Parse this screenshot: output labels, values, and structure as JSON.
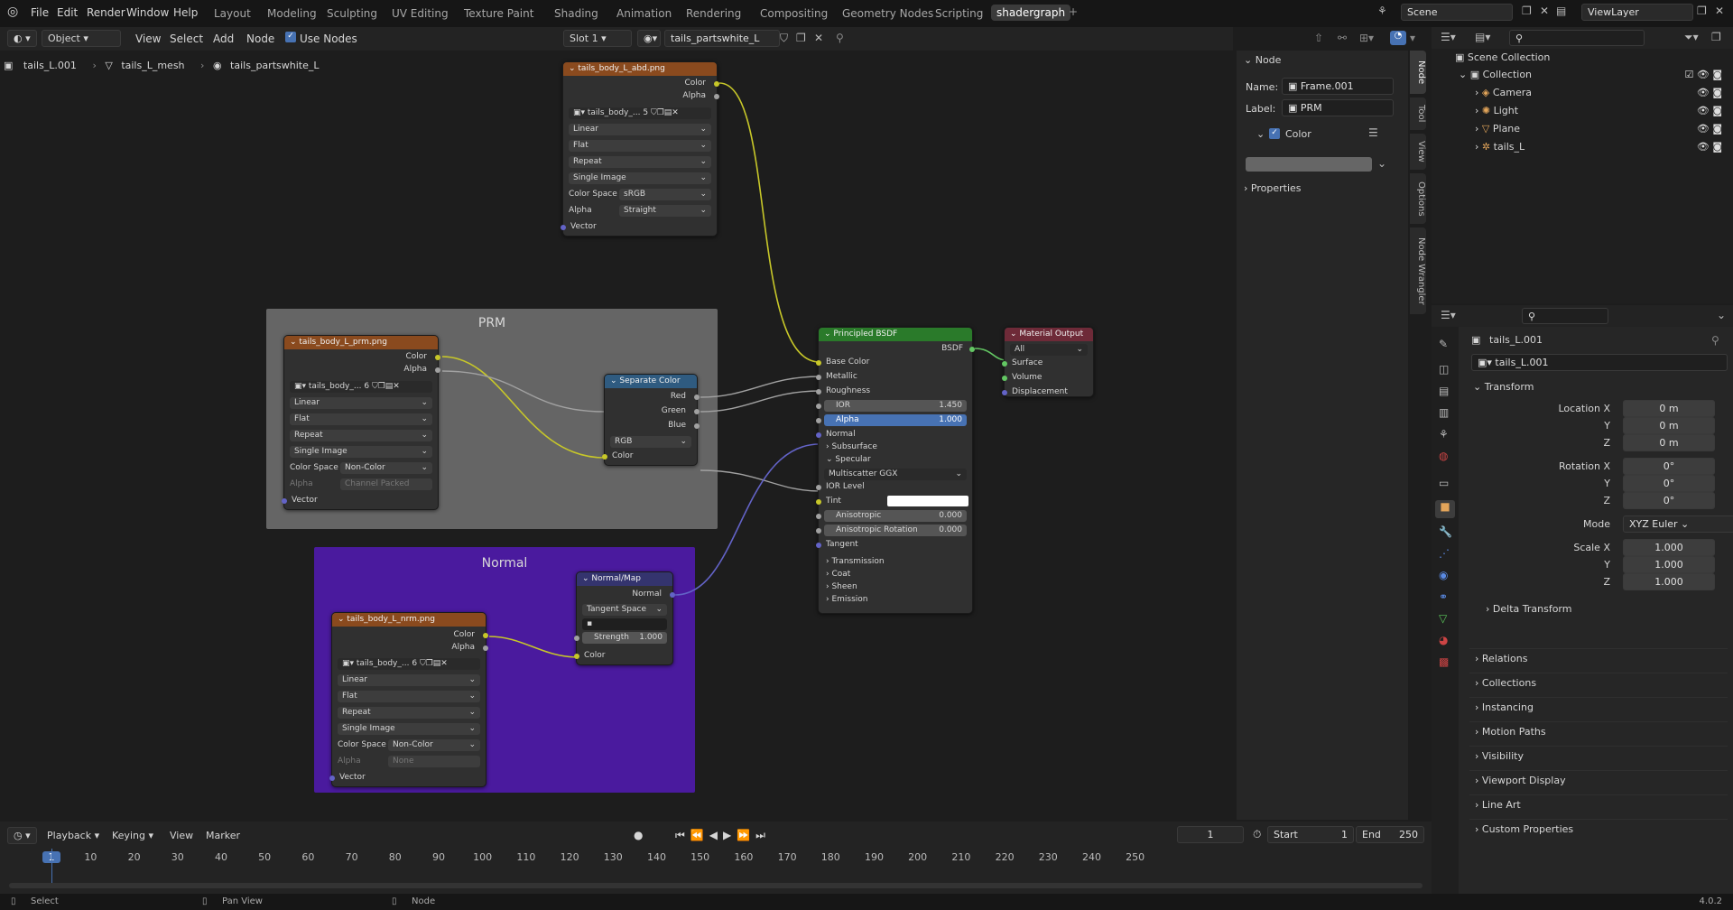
{
  "topbar": {
    "menus": [
      "File",
      "Edit",
      "Render",
      "Window",
      "Help"
    ],
    "workspaces": [
      "Layout",
      "Modeling",
      "Sculpting",
      "UV Editing",
      "Texture Paint",
      "Shading",
      "Animation",
      "Rendering",
      "Compositing",
      "Geometry Nodes",
      "Scripting",
      "shadergraph"
    ],
    "scene": "Scene",
    "viewlayer": "ViewLayer"
  },
  "header": {
    "mode": "Object",
    "menus": [
      "View",
      "Select",
      "Add",
      "Node"
    ],
    "use_nodes": "Use Nodes",
    "slot": "Slot 1",
    "material": "tails_partswhite_L"
  },
  "breadcrumb": [
    "tails_L.001",
    "tails_L_mesh",
    "tails_partswhite_L"
  ],
  "frames": {
    "prm": "PRM",
    "normal": "Normal"
  },
  "nodes": {
    "abd": {
      "title": "tails_body_L_abd.png",
      "out": [
        "Color",
        "Alpha"
      ],
      "img": "tails_body_...",
      "users": "5",
      "rows": [
        "Linear",
        "Flat",
        "Repeat",
        "Single Image"
      ],
      "cs_label": "Color Space",
      "cs": "sRGB",
      "alpha_label": "Alpha",
      "alpha": "Straight",
      "vector": "Vector"
    },
    "prm": {
      "title": "tails_body_L_prm.png",
      "out": [
        "Color",
        "Alpha"
      ],
      "img": "tails_body_...",
      "users": "6",
      "rows": [
        "Linear",
        "Flat",
        "Repeat",
        "Single Image"
      ],
      "cs_label": "Color Space",
      "cs": "Non-Color",
      "alpha_label": "Alpha",
      "alpha": "Channel Packed",
      "vector": "Vector"
    },
    "sep": {
      "title": "Separate Color",
      "out": [
        "Red",
        "Green",
        "Blue"
      ],
      "mode": "RGB",
      "in": "Color"
    },
    "nrm": {
      "title": "tails_body_L_nrm.png",
      "out": [
        "Color",
        "Alpha"
      ],
      "img": "tails_body_...",
      "users": "6",
      "rows": [
        "Linear",
        "Flat",
        "Repeat",
        "Single Image"
      ],
      "cs_label": "Color Space",
      "cs": "Non-Color",
      "alpha_label": "Alpha",
      "alpha": "None",
      "vector": "Vector"
    },
    "nmap": {
      "title": "Normal/Map",
      "out": "Normal",
      "space": "Tangent Space",
      "strength_label": "Strength",
      "strength": "1.000",
      "in": "Color"
    },
    "bsdf": {
      "title": "Principled BSDF",
      "out": "BSDF",
      "inputs": [
        "Base Color",
        "Metallic",
        "Roughness"
      ],
      "ior_label": "IOR",
      "ior": "1.450",
      "alpha_label": "Alpha",
      "alpha": "1.000",
      "normal": "Normal",
      "subsurface": "Subsurface",
      "specular": "Specular",
      "dist": "Multiscatter GGX",
      "ior_level": "IOR Level",
      "tint": "Tint",
      "aniso_label": "Anisotropic",
      "aniso": "0.000",
      "aniso_rot_label": "Anisotropic Rotation",
      "aniso_rot": "0.000",
      "tangent": "Tangent",
      "more": [
        "Transmission",
        "Coat",
        "Sheen",
        "Emission"
      ]
    },
    "out": {
      "title": "Material Output",
      "target": "All",
      "in": [
        "Surface",
        "Volume",
        "Displacement"
      ]
    }
  },
  "npanel": {
    "section": "Node",
    "name_label": "Name:",
    "name": "Frame.001",
    "label_label": "Label:",
    "label": "PRM",
    "color": "Color",
    "properties": "Properties",
    "tabs": [
      "Node",
      "Tool",
      "View",
      "Options",
      "Node Wrangler"
    ]
  },
  "outliner": {
    "root": "Scene Collection",
    "collection": "Collection",
    "items": [
      "Camera",
      "Light",
      "Plane",
      "tails_L"
    ]
  },
  "props": {
    "object": "tails_L.001",
    "data": "tails_L.001",
    "transform": "Transform",
    "loc_label": "Location X",
    "loc": [
      "0 m",
      "0 m",
      "0 m"
    ],
    "rot_label": "Rotation X",
    "rot": [
      "0°",
      "0°",
      "0°"
    ],
    "mode_label": "Mode",
    "mode": "XYZ Euler",
    "scale_label": "Scale X",
    "scale": [
      "1.000",
      "1.000",
      "1.000"
    ],
    "axes": [
      "Y",
      "Z"
    ],
    "delta": "Delta Transform",
    "sections": [
      "Relations",
      "Collections",
      "Instancing",
      "Motion Paths",
      "Visibility",
      "Viewport Display",
      "Line Art",
      "Custom Properties"
    ]
  },
  "timeline": {
    "menus": [
      "Playback",
      "Keying",
      "View",
      "Marker"
    ],
    "current": "1",
    "start_label": "Start",
    "start": "1",
    "end_label": "End",
    "end": "250",
    "ticks": [
      "1",
      "10",
      "20",
      "30",
      "40",
      "50",
      "60",
      "70",
      "80",
      "90",
      "100",
      "110",
      "120",
      "130",
      "140",
      "150",
      "160",
      "170",
      "180",
      "190",
      "200",
      "210",
      "220",
      "230",
      "240",
      "250"
    ]
  },
  "status": {
    "items": [
      "Select",
      "Pan View",
      "Node"
    ],
    "version": "4.0.2"
  }
}
